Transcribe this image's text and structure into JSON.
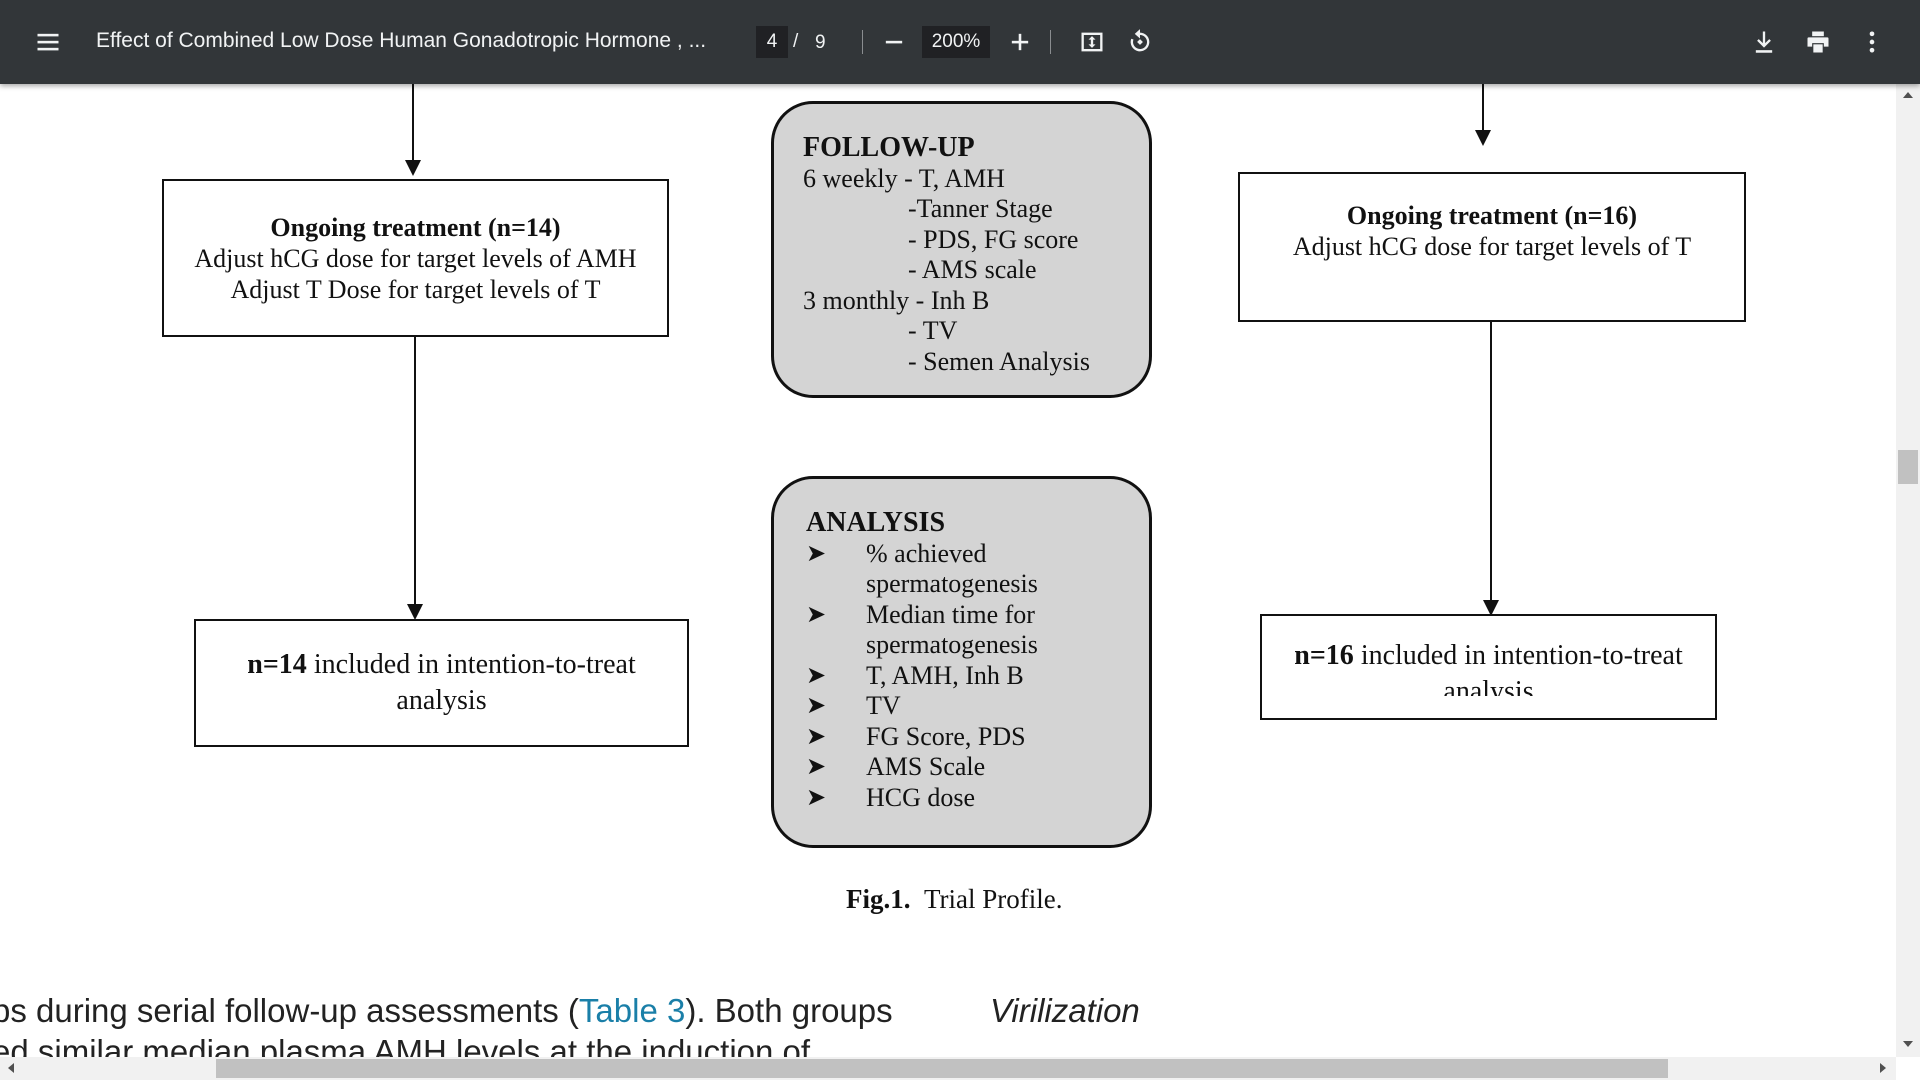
{
  "toolbar": {
    "menu_icon": "menu-icon",
    "title": "Effect of Combined Low Dose Human Gonadotropic Hormone , ...",
    "current_page": "4",
    "page_separator": "/",
    "total_pages": "9",
    "zoom": "200%",
    "icons": [
      "zoom-out-icon",
      "zoom-in-icon",
      "fit-to-page-icon",
      "rotate-icon",
      "download-icon",
      "print-icon",
      "more-options-icon"
    ]
  },
  "figure": {
    "left_ongoing": {
      "title": "Ongoing treatment (n=14)",
      "line1": "Adjust hCG dose for target levels of AMH",
      "line2": "Adjust T Dose for target levels of T"
    },
    "left_itt": {
      "bold": "n=14",
      "text": " included in intention-to-treat",
      "line2": "analysis"
    },
    "followup": {
      "title": "FOLLOW-UP",
      "lines": [
        "6 weekly - T, AMH",
        "-Tanner Stage",
        "- PDS, FG score",
        "- AMS scale",
        "3 monthly - Inh B",
        "- TV",
        "- Semen Analysis"
      ]
    },
    "analysis": {
      "title": "ANALYSIS",
      "bullet": "➤",
      "items": [
        "% achieved",
        "spermatogenesis",
        "Median time for",
        "spermatogenesis",
        "T, AMH, Inh B",
        "TV",
        "FG Score, PDS",
        "AMS Scale",
        "HCG dose"
      ]
    },
    "right_ongoing": {
      "title": "Ongoing treatment (n=16)",
      "line1": "Adjust hCG dose for target levels of T"
    },
    "right_itt": {
      "bold": "n=16",
      "text": " included in intention-to-treat",
      "line2": "analysis"
    },
    "caption_bold": "Fig.1.",
    "caption_text": "Trial Profile."
  },
  "body": {
    "line1_pre": "ps during serial follow-up assessments (",
    "line1_link": "Table 3",
    "line1_post": "). Both groups",
    "heading": "Virilization",
    "line2": "ed similar median plasma AMH levels at the induction of"
  }
}
